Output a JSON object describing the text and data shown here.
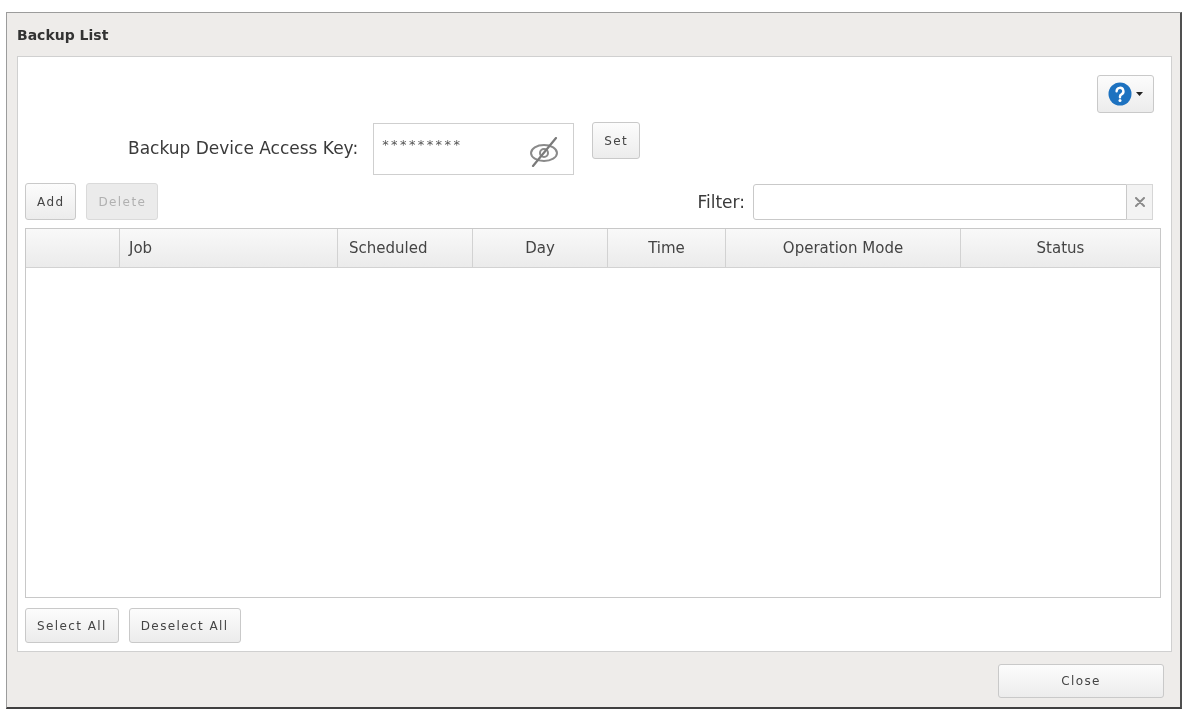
{
  "window": {
    "title": "Backup List"
  },
  "access_key": {
    "label": "Backup Device Access Key:",
    "value": "*********",
    "button": "Set"
  },
  "toolbar": {
    "buttons": [
      {
        "label": "Add",
        "disabled": false
      },
      {
        "label": "Delete",
        "disabled": true
      }
    ]
  },
  "filter": {
    "label": "Filter:"
  },
  "table": {
    "columns": [
      "Job",
      "Scheduled",
      "Day",
      "Time",
      "Operation Mode",
      "Status"
    ]
  },
  "selection_buttons": [
    "Select All",
    "Deselect All"
  ],
  "footer": {
    "buttons": [
      "Close"
    ]
  }
}
